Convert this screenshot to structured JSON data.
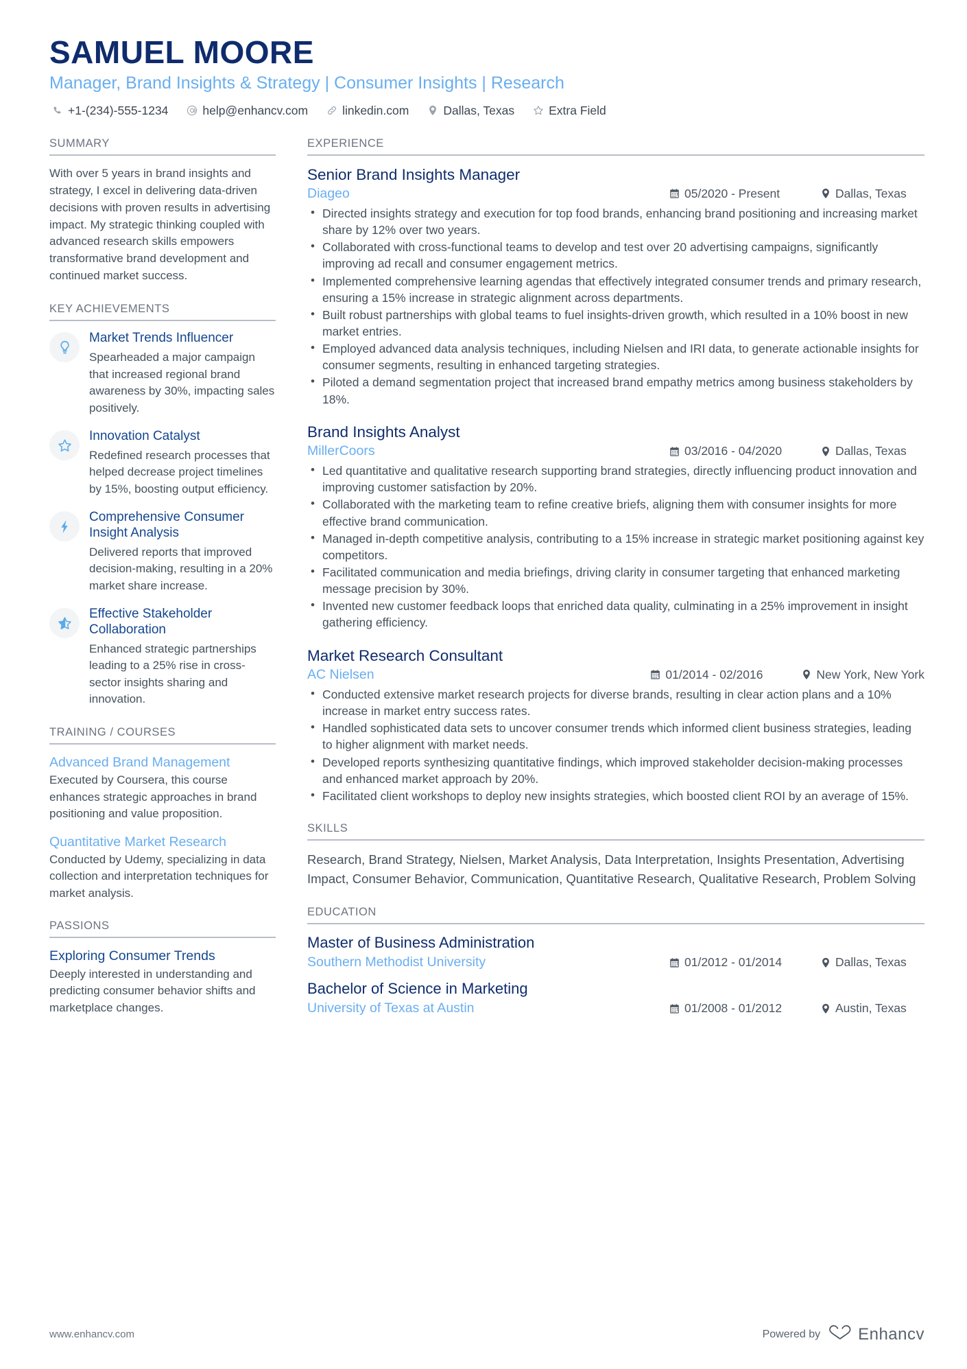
{
  "header": {
    "name": "SAMUEL MOORE",
    "title": "Manager, Brand Insights & Strategy | Consumer Insights | Research",
    "contacts": [
      {
        "icon": "phone-icon",
        "text": "+1-(234)-555-1234"
      },
      {
        "icon": "email-icon",
        "text": "help@enhancv.com"
      },
      {
        "icon": "link-icon",
        "text": "linkedin.com"
      },
      {
        "icon": "location-pin-icon",
        "text": "Dallas, Texas"
      },
      {
        "icon": "star-icon",
        "text": "Extra Field"
      }
    ]
  },
  "sidebar": {
    "summary": {
      "heading": "SUMMARY",
      "text": "With over 5 years in brand insights and strategy, I excel in delivering data-driven decisions with proven results in advertising impact. My strategic thinking coupled with advanced research skills empowers transformative brand development and continued market success."
    },
    "key_achievements": {
      "heading": "KEY ACHIEVEMENTS",
      "items": [
        {
          "icon": "lightbulb-icon",
          "title": "Market Trends Influencer",
          "description": "Spearheaded a major campaign that increased regional brand awareness by 30%, impacting sales positively."
        },
        {
          "icon": "star-outline-icon",
          "title": "Innovation Catalyst",
          "description": "Redefined research processes that helped decrease project timelines by 15%, boosting output efficiency."
        },
        {
          "icon": "lightning-bolt-icon",
          "title": "Comprehensive Consumer Insight Analysis",
          "description": "Delivered reports that improved decision-making, resulting in a 20% market share increase."
        },
        {
          "icon": "half-star-icon",
          "title": "Effective Stakeholder Collaboration",
          "description": "Enhanced strategic partnerships leading to a 25% rise in cross-sector insights sharing and innovation."
        }
      ]
    },
    "training": {
      "heading": "TRAINING / COURSES",
      "items": [
        {
          "title": "Advanced Brand Management",
          "description": "Executed by Coursera, this course enhances strategic approaches in brand positioning and value proposition."
        },
        {
          "title": "Quantitative Market Research",
          "description": "Conducted by Udemy, specializing in data collection and interpretation techniques for market analysis."
        }
      ]
    },
    "passions": {
      "heading": "PASSIONS",
      "items": [
        {
          "title": "Exploring Consumer Trends",
          "description": "Deeply interested in understanding and predicting consumer behavior shifts and marketplace changes."
        }
      ]
    }
  },
  "main": {
    "experience": {
      "heading": "EXPERIENCE",
      "jobs": [
        {
          "title": "Senior Brand Insights Manager",
          "company": "Diageo",
          "dates": "05/2020 - Present",
          "location": "Dallas, Texas",
          "bullets": [
            "Directed insights strategy and execution for top food brands, enhancing brand positioning and increasing market share by 12% over two years.",
            "Collaborated with cross-functional teams to develop and test over 20 advertising campaigns, significantly improving ad recall and consumer engagement metrics.",
            "Implemented comprehensive learning agendas that effectively integrated consumer trends and primary research, ensuring a 15% increase in strategic alignment across departments.",
            "Built robust partnerships with global teams to fuel insights-driven growth, which resulted in a 10% boost in new market entries.",
            "Employed advanced data analysis techniques, including Nielsen and IRI data, to generate actionable insights for consumer segments, resulting in enhanced targeting strategies.",
            "Piloted a demand segmentation project that increased brand empathy metrics among business stakeholders by 18%."
          ]
        },
        {
          "title": "Brand Insights Analyst",
          "company": "MillerCoors",
          "dates": "03/2016 - 04/2020",
          "location": "Dallas, Texas",
          "bullets": [
            "Led quantitative and qualitative research supporting brand strategies, directly influencing product innovation and improving customer satisfaction by 20%.",
            "Collaborated with the marketing team to refine creative briefs, aligning them with consumer insights for more effective brand communication.",
            "Managed in-depth competitive analysis, contributing to a 15% increase in strategic market positioning against key competitors.",
            "Facilitated communication and media briefings, driving clarity in consumer targeting that enhanced marketing message precision by 30%.",
            "Invented new customer feedback loops that enriched data quality, culminating in a 25% improvement in insight gathering efficiency."
          ]
        },
        {
          "title": "Market Research Consultant",
          "company": "AC Nielsen",
          "dates": "01/2014 - 02/2016",
          "location": "New York, New York",
          "bullets": [
            "Conducted extensive market research projects for diverse brands, resulting in clear action plans and a 10% increase in market entry success rates.",
            "Handled sophisticated data sets to uncover consumer trends which informed client business strategies, leading to higher alignment with market needs.",
            "Developed reports synthesizing quantitative findings, which improved stakeholder decision-making processes and enhanced market approach by 20%.",
            "Facilitated client workshops to deploy new insights strategies, which boosted client ROI by an average of 15%."
          ]
        }
      ]
    },
    "skills": {
      "heading": "SKILLS",
      "text": "Research, Brand Strategy, Nielsen, Market Analysis, Data Interpretation, Insights Presentation, Advertising Impact, Consumer Behavior, Communication, Quantitative Research, Qualitative Research, Problem Solving"
    },
    "education": {
      "heading": "EDUCATION",
      "items": [
        {
          "degree": "Master of Business Administration",
          "school": "Southern Methodist University",
          "dates": "01/2012 - 01/2014",
          "location": "Dallas, Texas"
        },
        {
          "degree": "Bachelor of Science in Marketing",
          "school": "University of Texas at Austin",
          "dates": "01/2008 - 01/2012",
          "location": "Austin, Texas"
        }
      ]
    }
  },
  "footer": {
    "url": "www.enhancv.com",
    "powered_by": "Powered by",
    "brand": "Enhancv"
  },
  "colors": {
    "navy": "#0e2c6d",
    "accent_blue": "#69aef0",
    "link_navy": "#14478f",
    "body_text": "#45515c",
    "section_rule": "#b9bec5"
  }
}
